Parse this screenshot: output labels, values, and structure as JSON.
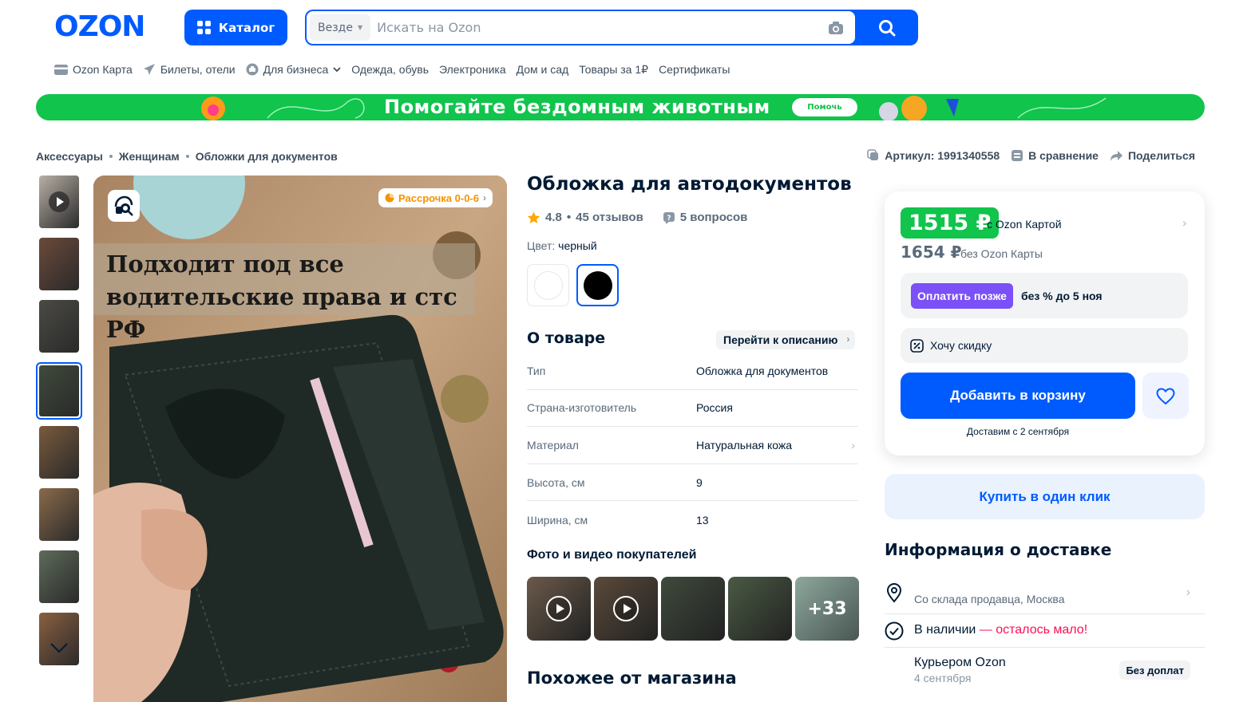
{
  "header": {
    "logo": "OZON",
    "catalog_label": "Каталог",
    "search": {
      "scope": "Везде",
      "placeholder": "Искать на Ozon",
      "value": ""
    }
  },
  "nav": [
    {
      "label": "Ozon Карта",
      "icon": "card-icon"
    },
    {
      "label": "Билеты, отели",
      "icon": "plane-icon"
    },
    {
      "label": "Для бизнеса",
      "icon": "business-icon",
      "dropdown": true
    },
    {
      "label": "Одежда, обувь"
    },
    {
      "label": "Электроника"
    },
    {
      "label": "Дом и сад"
    },
    {
      "label": "Товары за 1₽"
    },
    {
      "label": "Сертификаты"
    }
  ],
  "banner": {
    "text": "Помогайте бездомным животным",
    "button": "Помочь"
  },
  "breadcrumbs": [
    "Аксессуары",
    "Женщинам",
    "Обложки для документов"
  ],
  "actions": {
    "article": "Артикул: 1991340558",
    "compare": "В сравнение",
    "share": "Поделиться"
  },
  "gallery": {
    "installment": "Рассрочка 0-0-6",
    "caption_line1": "Подходит под все",
    "caption_line2": "водительские права и стс РФ",
    "thumbs": [
      {
        "video": true,
        "color": "#b8b0a6"
      },
      {
        "video": false,
        "color": "#6b4a3a"
      },
      {
        "video": false,
        "color": "#4b4a44"
      },
      {
        "video": false,
        "color": "#3f4a3c",
        "active": true
      },
      {
        "video": false,
        "color": "#7a5a3c"
      },
      {
        "video": false,
        "color": "#8a6a4a"
      },
      {
        "video": false,
        "color": "#5e6b5a"
      },
      {
        "video": false,
        "color": "#8a6040"
      }
    ]
  },
  "product": {
    "title": "Обложка для автодокументов",
    "rating": "4.8",
    "reviews": "45 отзывов",
    "questions": "5 вопросов",
    "color_label": "Цвет:",
    "color_value": "черный",
    "swatches": [
      {
        "name": "white",
        "color": "#ffffff"
      },
      {
        "name": "black",
        "color": "#000000",
        "selected": true
      }
    ],
    "about_title": "О товаре",
    "goto_desc": "Перейти к описанию",
    "specs": [
      {
        "k": "Тип",
        "v": "Обложка для документов"
      },
      {
        "k": "Страна-изготовитель",
        "v": "Россия"
      },
      {
        "k": "Материал",
        "v": "Натуральная кожа",
        "chevron": true
      },
      {
        "k": "Высота, см",
        "v": "9"
      },
      {
        "k": "Ширина, см",
        "v": "13"
      }
    ],
    "buyer_photos_title": "Фото и видео покупателей",
    "buyer_photos": [
      {
        "video": true,
        "color": "#6b5a4a"
      },
      {
        "video": true,
        "color": "#5a4a3a"
      },
      {
        "video": false,
        "color": "#3f4a3c"
      },
      {
        "video": false,
        "color": "#4a5a44"
      },
      {
        "more": "+33",
        "color": "#9fb5ab"
      }
    ],
    "similar_title": "Похожее от магазина"
  },
  "price": {
    "card_price": "1515 ₽",
    "card_note": "с Ozon Картой",
    "regular_price": "1654 ₽",
    "regular_note": "без Ozon Карты",
    "paylater_button": "Оплатить позже",
    "paylater_text": "без % до 5 ноя",
    "discount": "Хочу скидку",
    "add_to_cart": "Добавить в корзину",
    "delivery_note": "Доставим с 2 сентября",
    "one_click": "Купить в один клик"
  },
  "delivery": {
    "title": "Информация о доставке",
    "from": "Со склада продавца, Москва",
    "stock": "В наличии",
    "stock_warn": " — осталось мало!",
    "courier": "Курьером Ozon",
    "courier_date": "4 сентября",
    "courier_badge": "Без доплат"
  },
  "colors": {
    "brand": "#005bff",
    "green": "#10c44c",
    "purple": "#7b50f6",
    "warn": "#f91155",
    "installment": "#f59300"
  }
}
